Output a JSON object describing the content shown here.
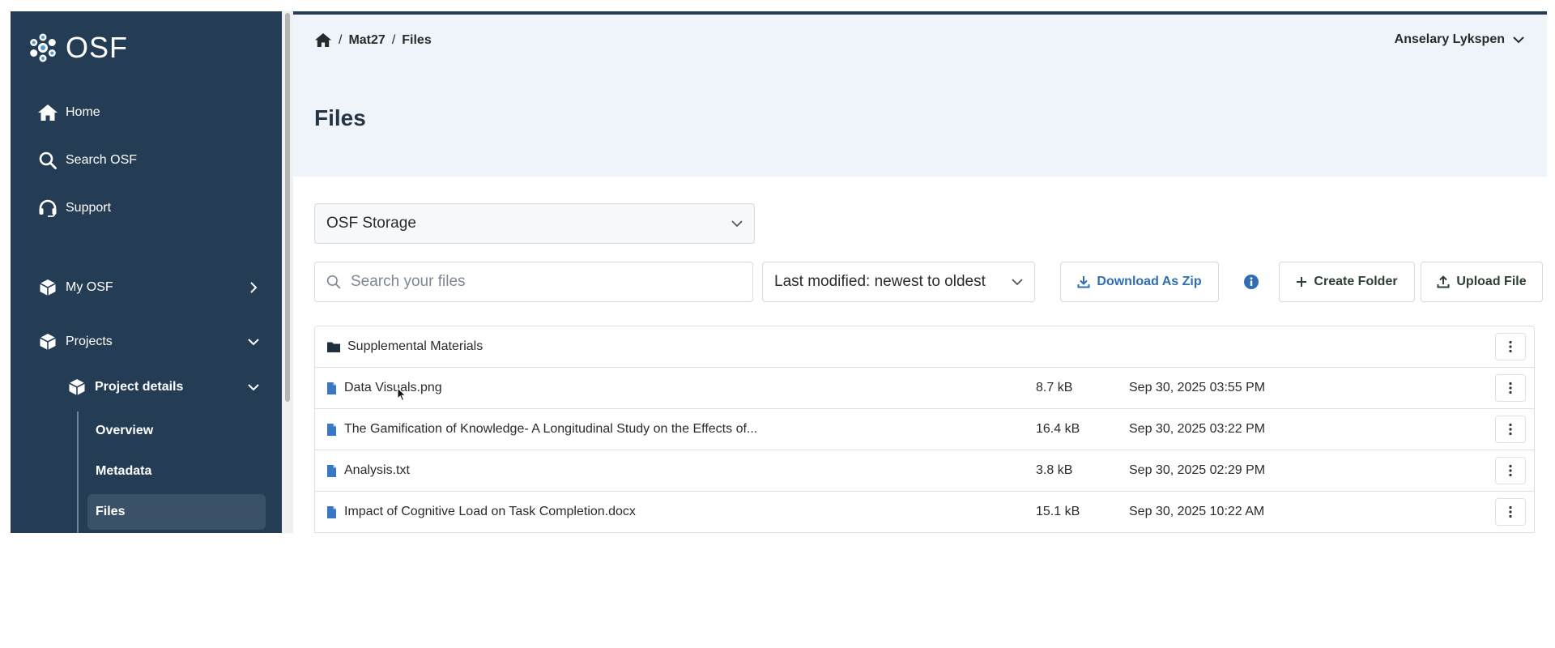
{
  "sidebar": {
    "logo_text": "OSF",
    "nav": {
      "home": "Home",
      "search": "Search OSF",
      "support": "Support",
      "my_osf": "My OSF",
      "projects": "Projects",
      "project_details": "Project details"
    },
    "sub_items": [
      "Overview",
      "Metadata",
      "Files"
    ],
    "active_sub_item": "Files"
  },
  "header": {
    "breadcrumb": [
      "Mat27",
      "Files"
    ],
    "user_name": "Anselary Lykspen",
    "page_title": "Files"
  },
  "storage_select": {
    "value": "OSF Storage"
  },
  "search": {
    "placeholder": "Search your files",
    "value": ""
  },
  "sort_select": {
    "value": "Last modified: newest to oldest"
  },
  "actions": {
    "download_zip": "Download As Zip",
    "create_folder": "Create Folder",
    "upload_file": "Upload File"
  },
  "files": [
    {
      "type": "folder",
      "name": "Supplemental Materials",
      "size": "",
      "modified": ""
    },
    {
      "type": "file",
      "name": "Data Visuals.png",
      "size": "8.7 kB",
      "modified": "Sep 30, 2025 03:55 PM"
    },
    {
      "type": "file",
      "name": "The Gamification of Knowledge- A Longitudinal Study on the Effects of...",
      "size": "16.4 kB",
      "modified": "Sep 30, 2025 03:22 PM"
    },
    {
      "type": "file",
      "name": "Analysis.txt",
      "size": "3.8 kB",
      "modified": "Sep 30, 2025 02:29 PM"
    },
    {
      "type": "file",
      "name": "Impact of Cognitive Load on Task Completion.docx",
      "size": "15.1 kB",
      "modified": "Sep 30, 2025 10:22 AM"
    }
  ],
  "colors": {
    "sidebar_bg": "#253c55",
    "header_bg": "#eef4f9",
    "accent_blue": "#2f6db4",
    "file_icon": "#3a78c3"
  }
}
